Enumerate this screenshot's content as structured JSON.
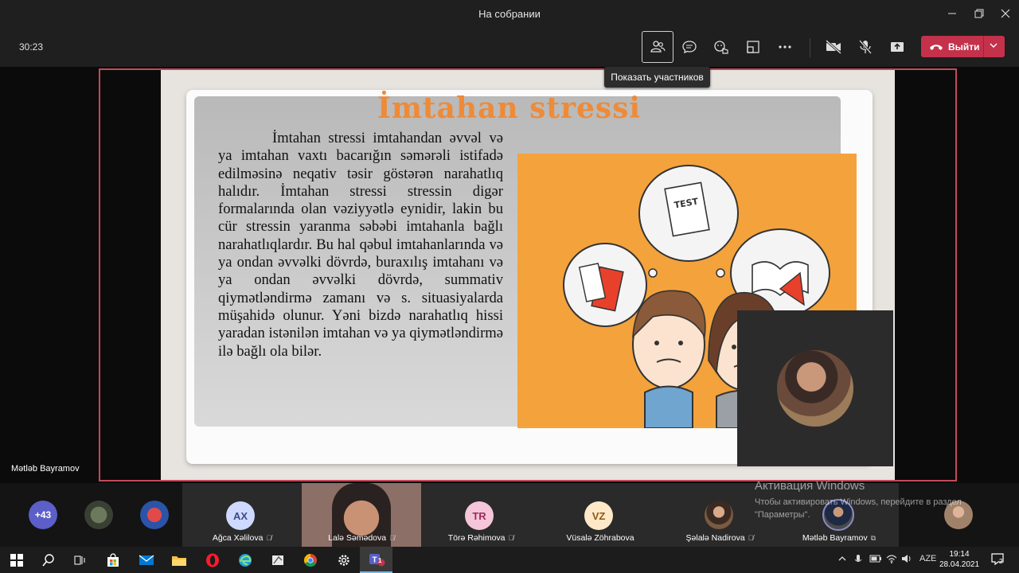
{
  "window": {
    "title": "На собрании"
  },
  "toolbar": {
    "timer": "30:23",
    "tooltip": "Показать участников",
    "leave_label": "Выйти"
  },
  "slide": {
    "title": "İmtahan stressi",
    "body": "İmtahan stressi imtahandan əvvəl və ya imtahan vaxtı bacarığın səmərəli istifadə edilməsinə neqativ təsir göstərən narahatlıq halıdır. İmtahan stressi stressin digər formalarında olan vəziyyətlə eynidir, lakin bu cür stressin yaranma səbəbi imtahanla bağlı narahatlıqlardır. Bu hal qəbul imtahanlarında və ya ondan əvvəlki dövrdə, buraxılış imtahanı və ya ondan əvvəlki dövrdə, summativ qiymətləndirmə zamanı və s. situasiyalarda müşahidə olunur. Yəni bizdə narahatlıq hissi yaradan istənilən imtahan və ya qiymətləndirmə ilə bağlı ola bilər.",
    "illustration_label": "TEST"
  },
  "stage": {
    "presenter_name": "Mətləb Bayramov"
  },
  "participants": {
    "overflow_count": "+43",
    "tiles": [
      {
        "initials": "AX",
        "name": "Ağca Xəlilova",
        "color": "#cfd9ff",
        "text_color": "#3b4a8a"
      },
      {
        "initials": "",
        "name": "Lalə Səmədova",
        "color": "",
        "text_color": ""
      },
      {
        "initials": "TR",
        "name": "Törə Rəhimova",
        "color": "#f5c6d9",
        "text_color": "#9b2d5c"
      },
      {
        "initials": "VZ",
        "name": "Vüsalə Zöhrabova",
        "color": "#fde8c8",
        "text_color": "#8a5a14"
      },
      {
        "initials": "",
        "name": "Şəlalə Nadirova",
        "color": "",
        "text_color": ""
      },
      {
        "initials": "",
        "name": "Mətləb Bayramov",
        "color": "",
        "text_color": ""
      }
    ]
  },
  "activation": {
    "title": "Активация Windows",
    "text": "Чтобы активировать Windows, перейдите в раздел \"Параметры\"."
  },
  "taskbar": {
    "language": "AZE",
    "time": "19:14",
    "date": "28.04.2021",
    "notification_count": "2",
    "teams_badge": "1"
  }
}
